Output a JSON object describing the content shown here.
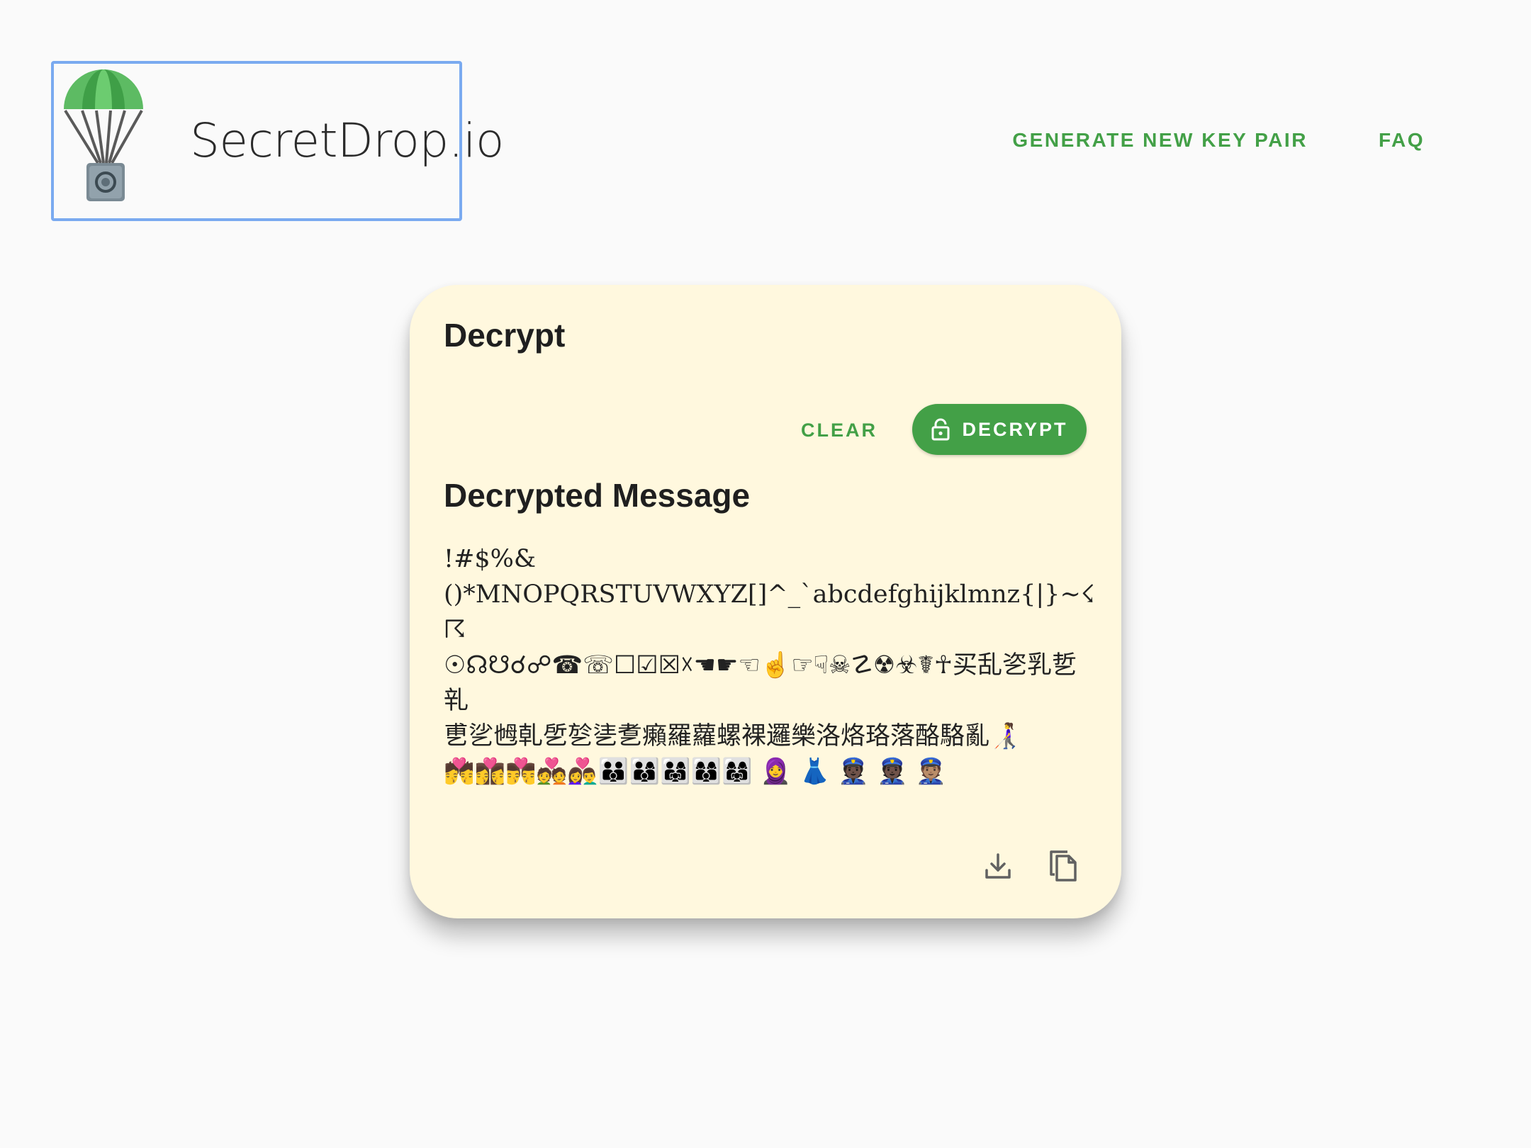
{
  "header": {
    "logo_text": "SecretDrop.io",
    "nav": {
      "generate_label": "GENERATE NEW KEY PAIR",
      "faq_label": "FAQ"
    }
  },
  "card": {
    "title": "Decrypt",
    "clear_label": "CLEAR",
    "decrypt_label": "DECRYPT",
    "section_title": "Decrypted Message",
    "message": "!#$%&\n()*MNOPQRSTUVWXYZ[]^_`abcdefghijklmnz{|}~☇☈\n☉☊☋☌☍☎☏☐☑☒☓☚☛☜☝☞☟☠☡☢☣☤☥买乱乲乳乴乵\n乶乷乸乹乺乻乼乽癩羅蘿螺裸邏樂洛烙珞落酪駱亂👩‍🦯\n💏👩‍❤️‍💋‍👩👨‍❤️‍💋‍👨💑👩‍❤️‍👨👪👨‍👩‍👦👨‍👩‍👧👩‍👩‍👦👩‍👩‍👧 🧕 👗 👮🏿 👮🏿 👮🏽",
    "colors": {
      "background": "#fff8de",
      "accent": "#43a047"
    }
  },
  "icons": {
    "download": "download-icon",
    "copy": "copy-icon",
    "lock": "lock-open-icon"
  }
}
